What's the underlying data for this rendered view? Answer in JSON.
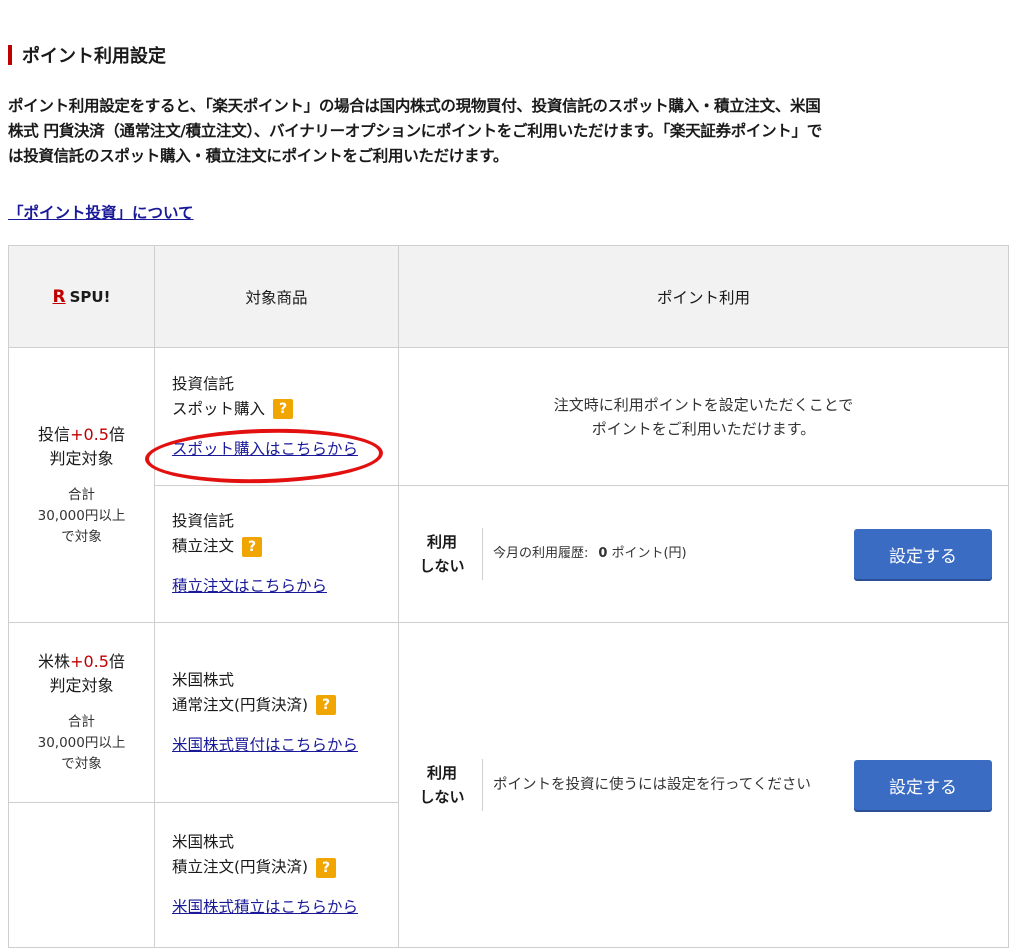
{
  "heading": "ポイント利用設定",
  "description": [
    "ポイント利用設定をすると、「楽天ポイント」の場合は国内株式の現物買付、投資信託のスポット購入・積立注文、米国",
    "株式 円貨決済（通常注文/積立注文）、バイナリーオプションにポイントをご利用いただけます。「楽天証券ポイント」で",
    "は投資信託のスポット購入・積立注文にポイントをご利用いただけます。"
  ],
  "about_link": "「ポイント投資」について",
  "table": {
    "header": {
      "brand_mark": "R",
      "brand_text": "SPU!",
      "product_col": "対象商品",
      "point_col": "ポイント利用"
    },
    "fund": {
      "spu": {
        "prefix": "投信",
        "mult": "+0.5",
        "suffix": "倍",
        "line2": "判定対象",
        "note1": "合計",
        "note2": "30,000円以上",
        "note3": "で対象"
      },
      "spot": {
        "line1": "投資信託",
        "line2": "スポット購入",
        "help": "?",
        "link": "スポット購入はこちらから",
        "msg1": "注文時に利用ポイントを設定いただくことで",
        "msg2": "ポイントをご利用いただけます。"
      },
      "tsumitate": {
        "line1": "投資信託",
        "line2": "積立注文",
        "help": "?",
        "link": "積立注文はこちらから",
        "status1": "利用",
        "status2": "しない",
        "history_label": "今月の利用履歴:",
        "history_value": "0",
        "history_unit": "ポイント(円)",
        "button": "設定する"
      }
    },
    "us": {
      "spu": {
        "prefix": "米株",
        "mult": "+0.5",
        "suffix": "倍",
        "line2": "判定対象",
        "note1": "合計",
        "note2": "30,000円以上",
        "note3": "で対象"
      },
      "normal": {
        "line1": "米国株式",
        "line2": "通常注文(円貨決済)",
        "help": "?",
        "link": "米国株式買付はこちらから"
      },
      "tsumitate": {
        "line1": "米国株式",
        "line2": "積立注文(円貨決済)",
        "help": "?",
        "link": "米国株式積立はこちらから"
      },
      "status1": "利用",
      "status2": "しない",
      "message": "ポイントを投資に使うには設定を行ってください",
      "button": "設定する"
    }
  },
  "colors": {
    "accent_red": "#bf0000",
    "button_blue": "#3b6cc4",
    "help_orange": "#f0a500",
    "link_blue": "#1a1a99"
  }
}
